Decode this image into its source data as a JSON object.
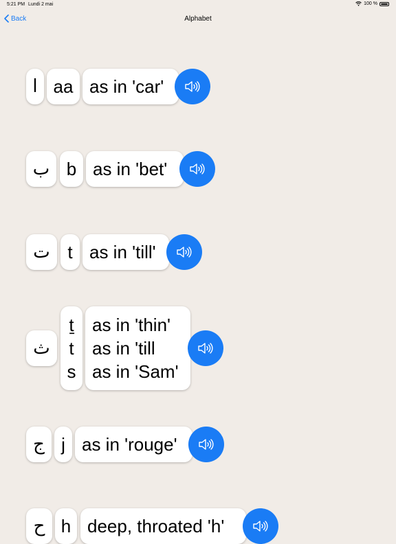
{
  "status": {
    "time": "5:21 PM",
    "date": "Lundi 2 mai",
    "battery": "100 %"
  },
  "nav": {
    "back_label": "Back",
    "title": "Alphabet"
  },
  "accent_color": "#1a7cf5",
  "letters": [
    {
      "arabic": "ا",
      "translit": "aa",
      "desc": "as in 'car'"
    },
    {
      "arabic": "ب",
      "translit": "b",
      "desc": "as in 'bet'"
    },
    {
      "arabic": "ت",
      "translit": "t",
      "desc": "as in 'till'"
    },
    {
      "arabic": "ث",
      "translit": [
        "ṯ",
        "t",
        "s"
      ],
      "desc": [
        "as in 'thin'",
        "as in 'till",
        "as in 'Sam'"
      ]
    },
    {
      "arabic": "ج",
      "translit": "j",
      "desc": "as in 'rouge'"
    },
    {
      "arabic": "ح",
      "translit": "h",
      "desc": "deep, throated 'h'"
    }
  ]
}
